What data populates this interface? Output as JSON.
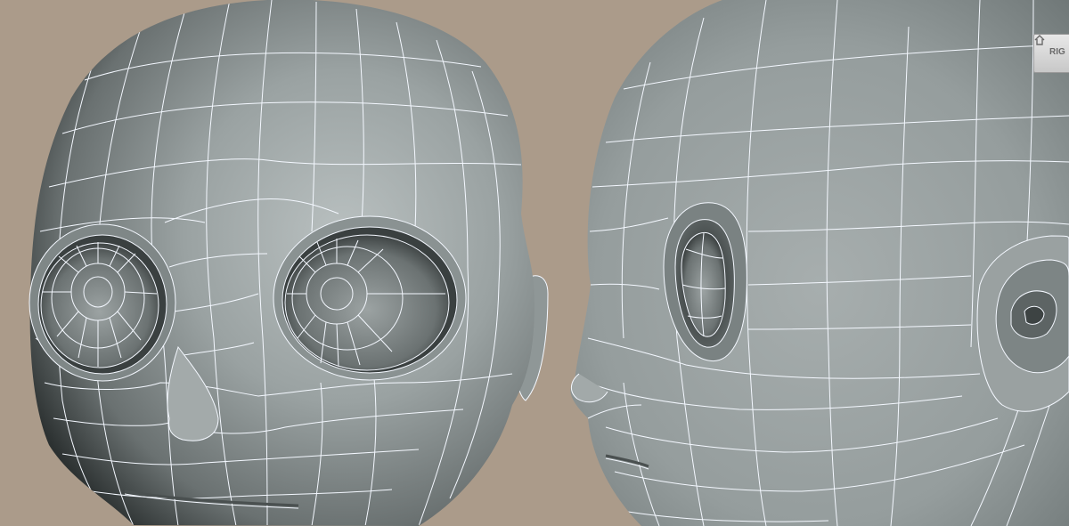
{
  "viewport": {
    "background_color": "#ab9b8a",
    "mesh_color": "#8e9696",
    "wire_color": "#f4f8ff"
  },
  "view_cube": {
    "face_label": "RIG",
    "icon": "home-icon"
  },
  "models": [
    {
      "name": "head-front-view",
      "view": "front"
    },
    {
      "name": "head-side-view",
      "view": "side"
    }
  ]
}
